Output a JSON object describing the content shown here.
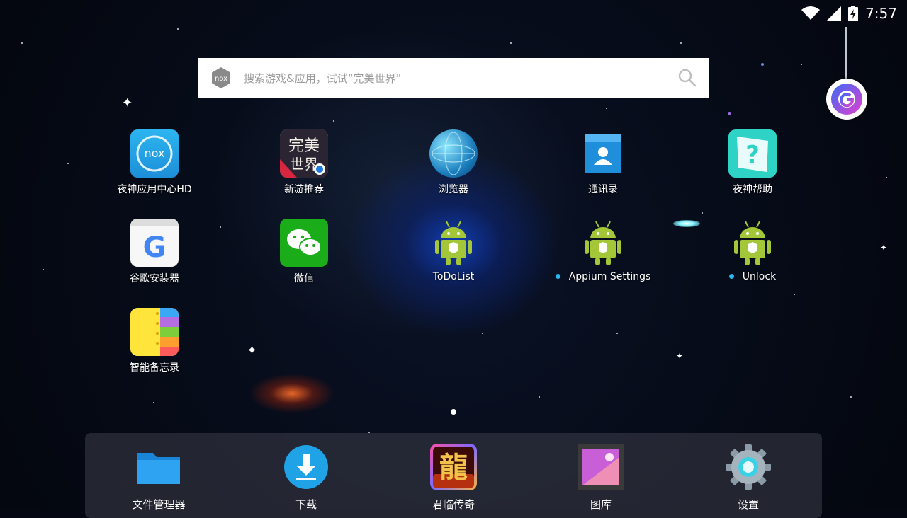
{
  "status_bar": {
    "time": "7:57",
    "icons": [
      "wifi-icon",
      "signal-icon",
      "battery-charging-icon"
    ]
  },
  "search": {
    "placeholder": "搜索游戏&应用，试试“完美世界”",
    "logo_text": "nox"
  },
  "apps": [
    {
      "label": "夜神应用中心HD",
      "icon": "nox-appcenter-icon"
    },
    {
      "label": "新游推荐",
      "icon": "new-games-icon"
    },
    {
      "label": "浏览器",
      "icon": "browser-globe-icon"
    },
    {
      "label": "通讯录",
      "icon": "contacts-icon"
    },
    {
      "label": "夜神帮助",
      "icon": "help-question-icon"
    },
    {
      "label": "谷歌安装器",
      "icon": "google-installer-icon"
    },
    {
      "label": "微信",
      "icon": "wechat-icon"
    },
    {
      "label": "ToDoList",
      "icon": "android-robot-icon"
    },
    {
      "label": "Appium Settings",
      "icon": "android-robot-icon"
    },
    {
      "label": "Unlock",
      "icon": "android-robot-icon"
    },
    {
      "label": "智能备忘录",
      "icon": "notebook-icon"
    }
  ],
  "dock": [
    {
      "label": "文件管理器",
      "icon": "folder-icon"
    },
    {
      "label": "下载",
      "icon": "download-icon"
    },
    {
      "label": "君临传奇",
      "icon": "dragon-game-icon"
    },
    {
      "label": "图库",
      "icon": "gallery-icon"
    },
    {
      "label": "设置",
      "icon": "settings-gear-icon"
    }
  ],
  "colors": {
    "accent": "#27b6f0",
    "wechat": "#1aad19",
    "nox_blue": "#1fa3e6"
  }
}
